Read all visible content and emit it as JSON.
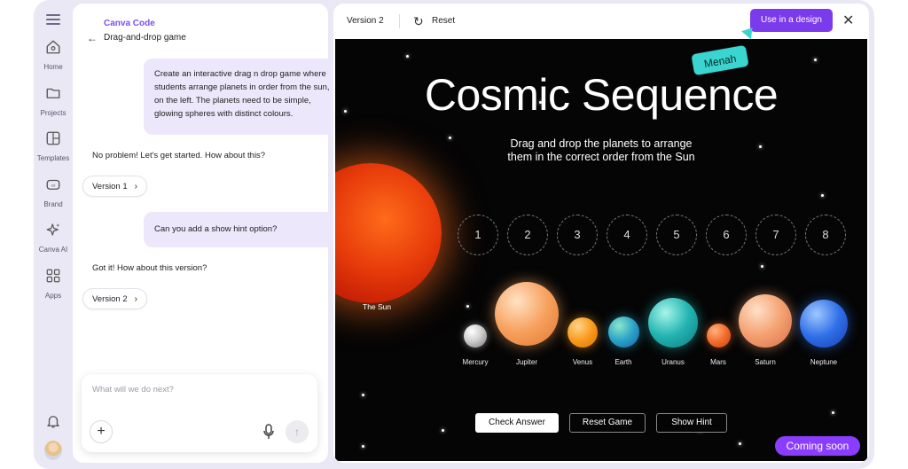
{
  "rail": {
    "items": [
      {
        "label": "Home",
        "icon": "home-icon"
      },
      {
        "label": "Projects",
        "icon": "folder-icon"
      },
      {
        "label": "Templates",
        "icon": "template-icon"
      },
      {
        "label": "Brand",
        "icon": "brand-icon"
      },
      {
        "label": "Canva AI",
        "icon": "sparkle-icon"
      },
      {
        "label": "Apps",
        "icon": "apps-icon"
      }
    ]
  },
  "chat": {
    "brand": "Canva Code",
    "breadcrumb": "Drag-and-drop game",
    "messages": [
      {
        "role": "user",
        "text": "Create an interactive drag n drop game where students arrange planets in order from the sun, on the left. The planets need to be simple, glowing spheres with distinct colours."
      },
      {
        "role": "assistant",
        "text": "No problem! Let's get started. How about this?"
      },
      {
        "role": "version",
        "text": "Version 1"
      },
      {
        "role": "user",
        "text": "Can you add a show hint option?"
      },
      {
        "role": "assistant",
        "text": "Got it! How about this version?"
      },
      {
        "role": "version",
        "text": "Version 2"
      }
    ],
    "composer_placeholder": "What will we do next?"
  },
  "preview": {
    "version_label": "Version 2",
    "reset_label": "Reset",
    "use_button": "Use in a design",
    "collaborator": "Menah",
    "game": {
      "title": "Cosmic Sequence",
      "subtitle_line1": "Drag and drop the planets to arrange",
      "subtitle_line2": "them in the correct order from the Sun",
      "sun_label": "The Sun",
      "slots": [
        "1",
        "2",
        "3",
        "4",
        "5",
        "6",
        "7",
        "8"
      ],
      "planets": [
        {
          "name": "Mercury",
          "color": "#cfcfcf"
        },
        {
          "name": "Jupiter",
          "color": "#f7a15e"
        },
        {
          "name": "Venus",
          "color": "#f99a1c"
        },
        {
          "name": "Earth",
          "color": "#2aa3c9"
        },
        {
          "name": "Uranus",
          "color": "#22b3b0"
        },
        {
          "name": "Mars",
          "color": "#f26b2a"
        },
        {
          "name": "Saturn",
          "color": "#f4a070"
        },
        {
          "name": "Neptune",
          "color": "#2f6fe8"
        }
      ],
      "buttons": {
        "check": "Check Answer",
        "reset": "Reset Game",
        "hint": "Show Hint"
      },
      "badge": "Coming soon"
    }
  }
}
